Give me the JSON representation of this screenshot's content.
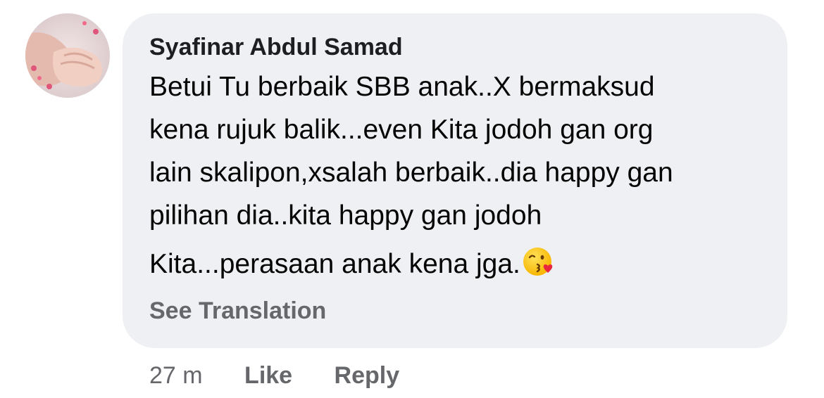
{
  "comment": {
    "author": "Syafinar Abdul Samad",
    "paragraphs": [
      "Betui Tu berbaik SBB anak..X bermaksud\nkena rujuk balik...even Kita jodoh gan org\nlain skalipon,xsalah berbaik..dia happy gan\npilihan dia..kita happy gan jodoh",
      "Kita...perasaan anak kena jga."
    ],
    "emoji": "face-blowing-a-kiss-icon",
    "see_translation": "See Translation"
  },
  "actions": {
    "timestamp": "27 m",
    "like_label": "Like",
    "reply_label": "Reply"
  },
  "colors": {
    "bubble_bg": "#eff0f4",
    "secondary_text": "#65676b",
    "primary_text": "#050505"
  }
}
